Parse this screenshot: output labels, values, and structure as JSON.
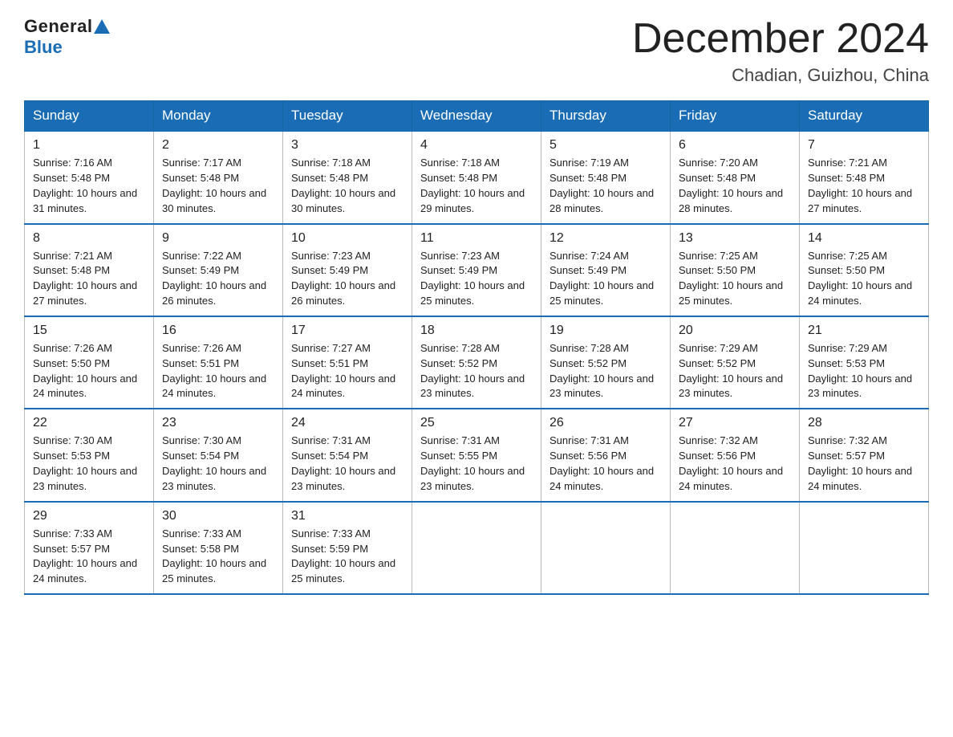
{
  "logo": {
    "general": "General",
    "blue": "Blue"
  },
  "title": "December 2024",
  "location": "Chadian, Guizhou, China",
  "days_header": [
    "Sunday",
    "Monday",
    "Tuesday",
    "Wednesday",
    "Thursday",
    "Friday",
    "Saturday"
  ],
  "weeks": [
    [
      {
        "day": "1",
        "sunrise": "7:16 AM",
        "sunset": "5:48 PM",
        "daylight": "10 hours and 31 minutes."
      },
      {
        "day": "2",
        "sunrise": "7:17 AM",
        "sunset": "5:48 PM",
        "daylight": "10 hours and 30 minutes."
      },
      {
        "day": "3",
        "sunrise": "7:18 AM",
        "sunset": "5:48 PM",
        "daylight": "10 hours and 30 minutes."
      },
      {
        "day": "4",
        "sunrise": "7:18 AM",
        "sunset": "5:48 PM",
        "daylight": "10 hours and 29 minutes."
      },
      {
        "day": "5",
        "sunrise": "7:19 AM",
        "sunset": "5:48 PM",
        "daylight": "10 hours and 28 minutes."
      },
      {
        "day": "6",
        "sunrise": "7:20 AM",
        "sunset": "5:48 PM",
        "daylight": "10 hours and 28 minutes."
      },
      {
        "day": "7",
        "sunrise": "7:21 AM",
        "sunset": "5:48 PM",
        "daylight": "10 hours and 27 minutes."
      }
    ],
    [
      {
        "day": "8",
        "sunrise": "7:21 AM",
        "sunset": "5:48 PM",
        "daylight": "10 hours and 27 minutes."
      },
      {
        "day": "9",
        "sunrise": "7:22 AM",
        "sunset": "5:49 PM",
        "daylight": "10 hours and 26 minutes."
      },
      {
        "day": "10",
        "sunrise": "7:23 AM",
        "sunset": "5:49 PM",
        "daylight": "10 hours and 26 minutes."
      },
      {
        "day": "11",
        "sunrise": "7:23 AM",
        "sunset": "5:49 PM",
        "daylight": "10 hours and 25 minutes."
      },
      {
        "day": "12",
        "sunrise": "7:24 AM",
        "sunset": "5:49 PM",
        "daylight": "10 hours and 25 minutes."
      },
      {
        "day": "13",
        "sunrise": "7:25 AM",
        "sunset": "5:50 PM",
        "daylight": "10 hours and 25 minutes."
      },
      {
        "day": "14",
        "sunrise": "7:25 AM",
        "sunset": "5:50 PM",
        "daylight": "10 hours and 24 minutes."
      }
    ],
    [
      {
        "day": "15",
        "sunrise": "7:26 AM",
        "sunset": "5:50 PM",
        "daylight": "10 hours and 24 minutes."
      },
      {
        "day": "16",
        "sunrise": "7:26 AM",
        "sunset": "5:51 PM",
        "daylight": "10 hours and 24 minutes."
      },
      {
        "day": "17",
        "sunrise": "7:27 AM",
        "sunset": "5:51 PM",
        "daylight": "10 hours and 24 minutes."
      },
      {
        "day": "18",
        "sunrise": "7:28 AM",
        "sunset": "5:52 PM",
        "daylight": "10 hours and 23 minutes."
      },
      {
        "day": "19",
        "sunrise": "7:28 AM",
        "sunset": "5:52 PM",
        "daylight": "10 hours and 23 minutes."
      },
      {
        "day": "20",
        "sunrise": "7:29 AM",
        "sunset": "5:52 PM",
        "daylight": "10 hours and 23 minutes."
      },
      {
        "day": "21",
        "sunrise": "7:29 AM",
        "sunset": "5:53 PM",
        "daylight": "10 hours and 23 minutes."
      }
    ],
    [
      {
        "day": "22",
        "sunrise": "7:30 AM",
        "sunset": "5:53 PM",
        "daylight": "10 hours and 23 minutes."
      },
      {
        "day": "23",
        "sunrise": "7:30 AM",
        "sunset": "5:54 PM",
        "daylight": "10 hours and 23 minutes."
      },
      {
        "day": "24",
        "sunrise": "7:31 AM",
        "sunset": "5:54 PM",
        "daylight": "10 hours and 23 minutes."
      },
      {
        "day": "25",
        "sunrise": "7:31 AM",
        "sunset": "5:55 PM",
        "daylight": "10 hours and 23 minutes."
      },
      {
        "day": "26",
        "sunrise": "7:31 AM",
        "sunset": "5:56 PM",
        "daylight": "10 hours and 24 minutes."
      },
      {
        "day": "27",
        "sunrise": "7:32 AM",
        "sunset": "5:56 PM",
        "daylight": "10 hours and 24 minutes."
      },
      {
        "day": "28",
        "sunrise": "7:32 AM",
        "sunset": "5:57 PM",
        "daylight": "10 hours and 24 minutes."
      }
    ],
    [
      {
        "day": "29",
        "sunrise": "7:33 AM",
        "sunset": "5:57 PM",
        "daylight": "10 hours and 24 minutes."
      },
      {
        "day": "30",
        "sunrise": "7:33 AM",
        "sunset": "5:58 PM",
        "daylight": "10 hours and 25 minutes."
      },
      {
        "day": "31",
        "sunrise": "7:33 AM",
        "sunset": "5:59 PM",
        "daylight": "10 hours and 25 minutes."
      },
      null,
      null,
      null,
      null
    ]
  ]
}
